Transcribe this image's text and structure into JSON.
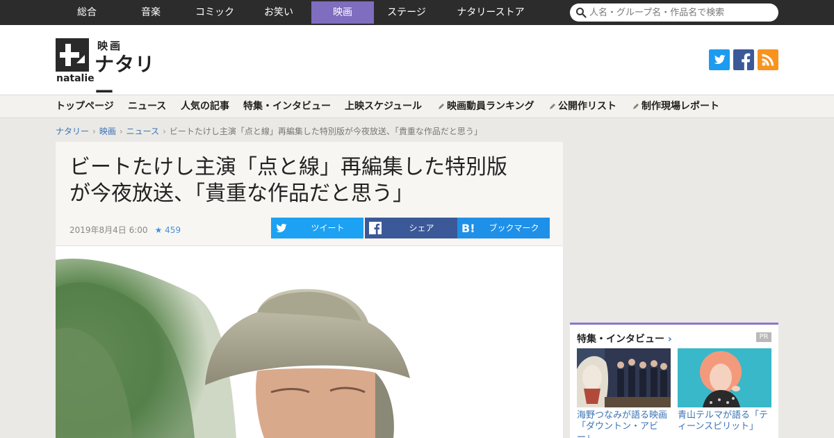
{
  "top_categories": [
    {
      "label": "総合",
      "active": false
    },
    {
      "label": "音楽",
      "active": false
    },
    {
      "label": "コミック",
      "active": false
    },
    {
      "label": "お笑い",
      "active": false
    },
    {
      "label": "映画",
      "active": true
    },
    {
      "label": "ステージ",
      "active": false
    },
    {
      "label": "ナタリーストア",
      "active": false
    }
  ],
  "search": {
    "placeholder": "人名・グループ名・作品名で検索"
  },
  "logo": {
    "sub": "映画",
    "name": "ナタリー",
    "en": "natalie"
  },
  "social": [
    {
      "name": "twitter",
      "color": "#1d9bf0"
    },
    {
      "name": "facebook",
      "color": "#3b5998"
    },
    {
      "name": "rss",
      "color": "#f7931e"
    }
  ],
  "subnav": [
    {
      "label": "トップページ",
      "pen": false
    },
    {
      "label": "ニュース",
      "pen": false
    },
    {
      "label": "人気の記事",
      "pen": false
    },
    {
      "label": "特集・インタビュー",
      "pen": false
    },
    {
      "label": "上映スケジュール",
      "pen": false
    },
    {
      "label": "映画動員ランキング",
      "pen": true
    },
    {
      "label": "公開作リスト",
      "pen": true
    },
    {
      "label": "制作現場レポート",
      "pen": true
    }
  ],
  "breadcrumb": {
    "links": [
      "ナタリー",
      "映画",
      "ニュース"
    ],
    "current": "ビートたけし主演「点と線」再編集した特別版が今夜放送、「貴重な作品だと思う」"
  },
  "article": {
    "title_line1": "ビートたけし主演「点と線」再編集した特別版",
    "title_line2": "が今夜放送、「貴重な作品だと思う」",
    "date": "2019年8月4日 6:00",
    "favorites": "459"
  },
  "share_buttons": [
    {
      "label": "ツイート",
      "color": "#1da1f2"
    },
    {
      "label": "シェア",
      "color": "#3b5998"
    },
    {
      "label": "ブックマーク",
      "color": "#1e90e8"
    }
  ],
  "sidebar": {
    "title": "特集・インタビュー",
    "pr": "PR",
    "cards": [
      {
        "caption": "海野つなみが語る映画「ダウントン・アビー」"
      },
      {
        "caption": "青山テルマが語る「ティーンスピリット」"
      }
    ]
  }
}
